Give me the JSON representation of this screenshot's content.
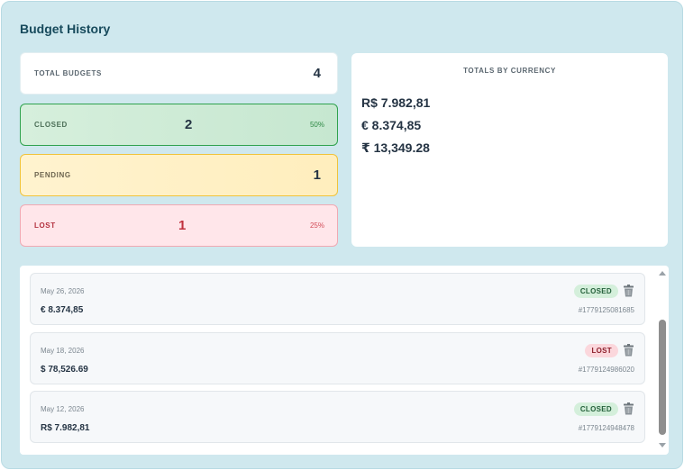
{
  "title": "Budget History",
  "stats": {
    "total": {
      "label": "TOTAL BUDGETS",
      "value": "4"
    },
    "closed": {
      "label": "CLOSED",
      "value": "2",
      "percent": "50%"
    },
    "pending": {
      "label": "PENDING",
      "value": "1"
    },
    "lost": {
      "label": "LOST",
      "value": "1",
      "percent": "25%"
    }
  },
  "totals_by_currency": {
    "heading": "TOTALS BY CURRENCY",
    "lines": [
      "R$ 7.982,81",
      "€ 8.374,85",
      "₹ 13,349.28"
    ]
  },
  "entries": [
    {
      "date": "May 26, 2026",
      "amount": "€ 8.374,85",
      "status": "CLOSED",
      "id": "#1779125081685"
    },
    {
      "date": "May 18, 2026",
      "amount": "$ 78,526.69",
      "status": "LOST",
      "id": "#1779124986020"
    },
    {
      "date": "May 12, 2026",
      "amount": "R$ 7.982,81",
      "status": "CLOSED",
      "id": "#1779124948478"
    }
  ],
  "icons": {
    "delete": "trash-icon",
    "scroll_up": "arrow-up-icon",
    "scroll_down": "arrow-down-icon"
  },
  "colors": {
    "closed": "#2fa24e",
    "pending": "#f0c33a",
    "lost": "#c0303d",
    "title": "#174a5c"
  }
}
